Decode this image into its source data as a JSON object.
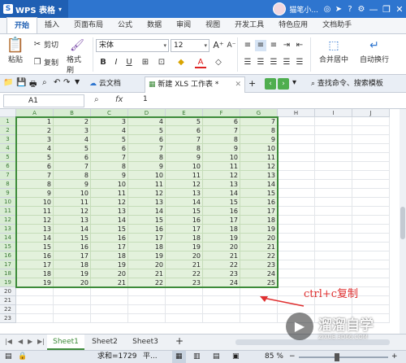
{
  "titlebar": {
    "app_name": "WPS 表格",
    "user_name": "猫笔小..."
  },
  "menu": {
    "tabs": [
      "开始",
      "插入",
      "页面布局",
      "公式",
      "数据",
      "审阅",
      "视图",
      "开发工具",
      "特色应用",
      "文档助手"
    ]
  },
  "ribbon": {
    "paste": "粘贴",
    "cut": "剪切",
    "copy": "复制",
    "format_painter": "格式刷",
    "font_name": "宋体",
    "font_size": "12",
    "merge_center": "合并居中",
    "wrap_text": "自动换行"
  },
  "docbar": {
    "cloud_docs": "云文档",
    "active_file": "新建 XLS 工作表 *",
    "search": "查找命令、搜索模板"
  },
  "formula": {
    "cell_ref": "A1",
    "fx": "fx",
    "value": "1"
  },
  "grid": {
    "columns": [
      "A",
      "B",
      "C",
      "D",
      "E",
      "F",
      "G",
      "H",
      "I",
      "J"
    ],
    "rows": [
      "1",
      "2",
      "3",
      "4",
      "5",
      "6",
      "7",
      "8",
      "9",
      "10",
      "11",
      "12",
      "13",
      "14",
      "15",
      "16",
      "17",
      "18",
      "19",
      "20",
      "21",
      "22",
      "23"
    ],
    "data": [
      [
        1,
        2,
        3,
        4,
        5,
        6,
        7
      ],
      [
        2,
        3,
        4,
        5,
        6,
        7,
        8
      ],
      [
        3,
        4,
        5,
        6,
        7,
        8,
        9
      ],
      [
        4,
        5,
        6,
        7,
        8,
        9,
        10
      ],
      [
        5,
        6,
        7,
        8,
        9,
        10,
        11
      ],
      [
        6,
        7,
        8,
        9,
        10,
        11,
        12
      ],
      [
        7,
        8,
        9,
        10,
        11,
        12,
        13
      ],
      [
        8,
        9,
        10,
        11,
        12,
        13,
        14
      ],
      [
        9,
        10,
        11,
        12,
        13,
        14,
        15
      ],
      [
        10,
        11,
        12,
        13,
        14,
        15,
        16
      ],
      [
        11,
        12,
        13,
        14,
        15,
        16,
        17
      ],
      [
        12,
        13,
        14,
        15,
        16,
        17,
        18
      ],
      [
        13,
        14,
        15,
        16,
        17,
        18,
        19
      ],
      [
        14,
        15,
        16,
        17,
        18,
        19,
        20
      ],
      [
        15,
        16,
        17,
        18,
        19,
        20,
        21
      ],
      [
        16,
        17,
        18,
        19,
        20,
        21,
        22
      ],
      [
        17,
        18,
        19,
        20,
        21,
        22,
        23
      ],
      [
        18,
        19,
        20,
        21,
        22,
        23,
        24
      ],
      [
        19,
        20,
        21,
        22,
        23,
        24,
        25
      ]
    ]
  },
  "annotation": "ctrl+c复制",
  "sheets": [
    "Sheet1",
    "Sheet2",
    "Sheet3"
  ],
  "status": {
    "sum": "求和=1729",
    "avg_prefix": "平...",
    "zoom": "85 %"
  },
  "watermark": {
    "name": "溜溜自学",
    "url": "ZIXUE.3D66.COM"
  },
  "colors": {
    "brand": "#2e75cf",
    "selection": "#3d8b3a",
    "annotation": "#e03030"
  }
}
